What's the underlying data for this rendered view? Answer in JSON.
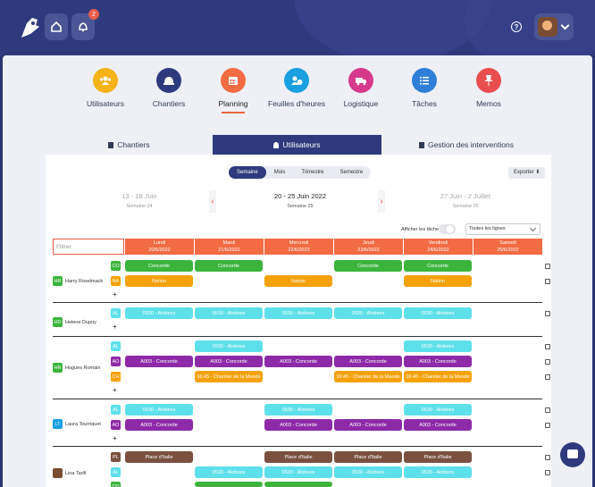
{
  "header": {
    "notification_count": "2",
    "help_label": "?"
  },
  "modules": [
    {
      "label": "Utilisateurs",
      "color": "#f5b31a",
      "icon": "users-icon"
    },
    {
      "label": "Chantiers",
      "color": "#2f3a7e",
      "icon": "helmet-icon"
    },
    {
      "label": "Planning",
      "color": "#f26b43",
      "icon": "calendar-icon"
    },
    {
      "label": "Feuilles d'heures",
      "color": "#1a9fe0",
      "icon": "clock-user-icon"
    },
    {
      "label": "Logistique",
      "color": "#d63a8a",
      "icon": "truck-icon"
    },
    {
      "label": "Tâches",
      "color": "#2f7fd8",
      "icon": "checklist-icon"
    },
    {
      "label": "Memos",
      "color": "#e84e4e",
      "icon": "pin-icon"
    }
  ],
  "tabs": [
    "Chantiers",
    "Utilisateurs",
    "Gestion des interventions"
  ],
  "periods": [
    "Semaine",
    "Mois",
    "Trimestre",
    "Semestre"
  ],
  "export_label": "Exporter",
  "weeks": {
    "prev": {
      "range": "13 - 18 Juin",
      "label": "Semaine 24"
    },
    "current": {
      "range": "20 - 25 Juin 2022",
      "label": "Semaine 25"
    },
    "next": {
      "range": "27 Juin - 2 Juillet",
      "label": "Semaine 26"
    }
  },
  "toggle_label": "Afficher les tâches",
  "lines_select": "Toutes les lignes",
  "filter_placeholder": "Filtrer",
  "days": [
    {
      "name": "Lundi",
      "date": "20/6/2022"
    },
    {
      "name": "Mardi",
      "date": "21/6/2022"
    },
    {
      "name": "Mercredi",
      "date": "22/6/2022"
    },
    {
      "name": "Jeudi",
      "date": "23/6/2022"
    },
    {
      "name": "Vendredi",
      "date": "24/6/2022"
    },
    {
      "name": "Samedi",
      "date": "25/6/2022"
    }
  ],
  "colors": {
    "green": "#3cb43c",
    "orange": "#f5a20a",
    "cyan": "#5ee0ea",
    "purple": "#8e2aa8",
    "brown": "#7a5040"
  },
  "people": [
    {
      "initials": "HR",
      "name": "Harry Roselmack"
    },
    {
      "initials": "HD",
      "name": "Helene Dupuy"
    },
    {
      "initials": "HR",
      "name": "Hugues Romain"
    },
    {
      "initials": "LT",
      "name": "Laura Tourriquet"
    },
    {
      "initials": "",
      "name": "Lina Tarifi"
    }
  ],
  "codes": [
    "CO",
    "NA",
    "AL",
    "AL",
    "AO",
    "CH",
    "AL",
    "AO",
    "PL",
    "AL",
    "CO"
  ],
  "labels": {
    "concorde": "Concorde",
    "nation": "Nation",
    "alobees": "0530 - Alobees",
    "ao_concorde": "A003 - Concorde",
    "chantier_mande": "16:45 - Chantier de la Mande",
    "place_italie": "Place d'Italie"
  },
  "plus": "+"
}
